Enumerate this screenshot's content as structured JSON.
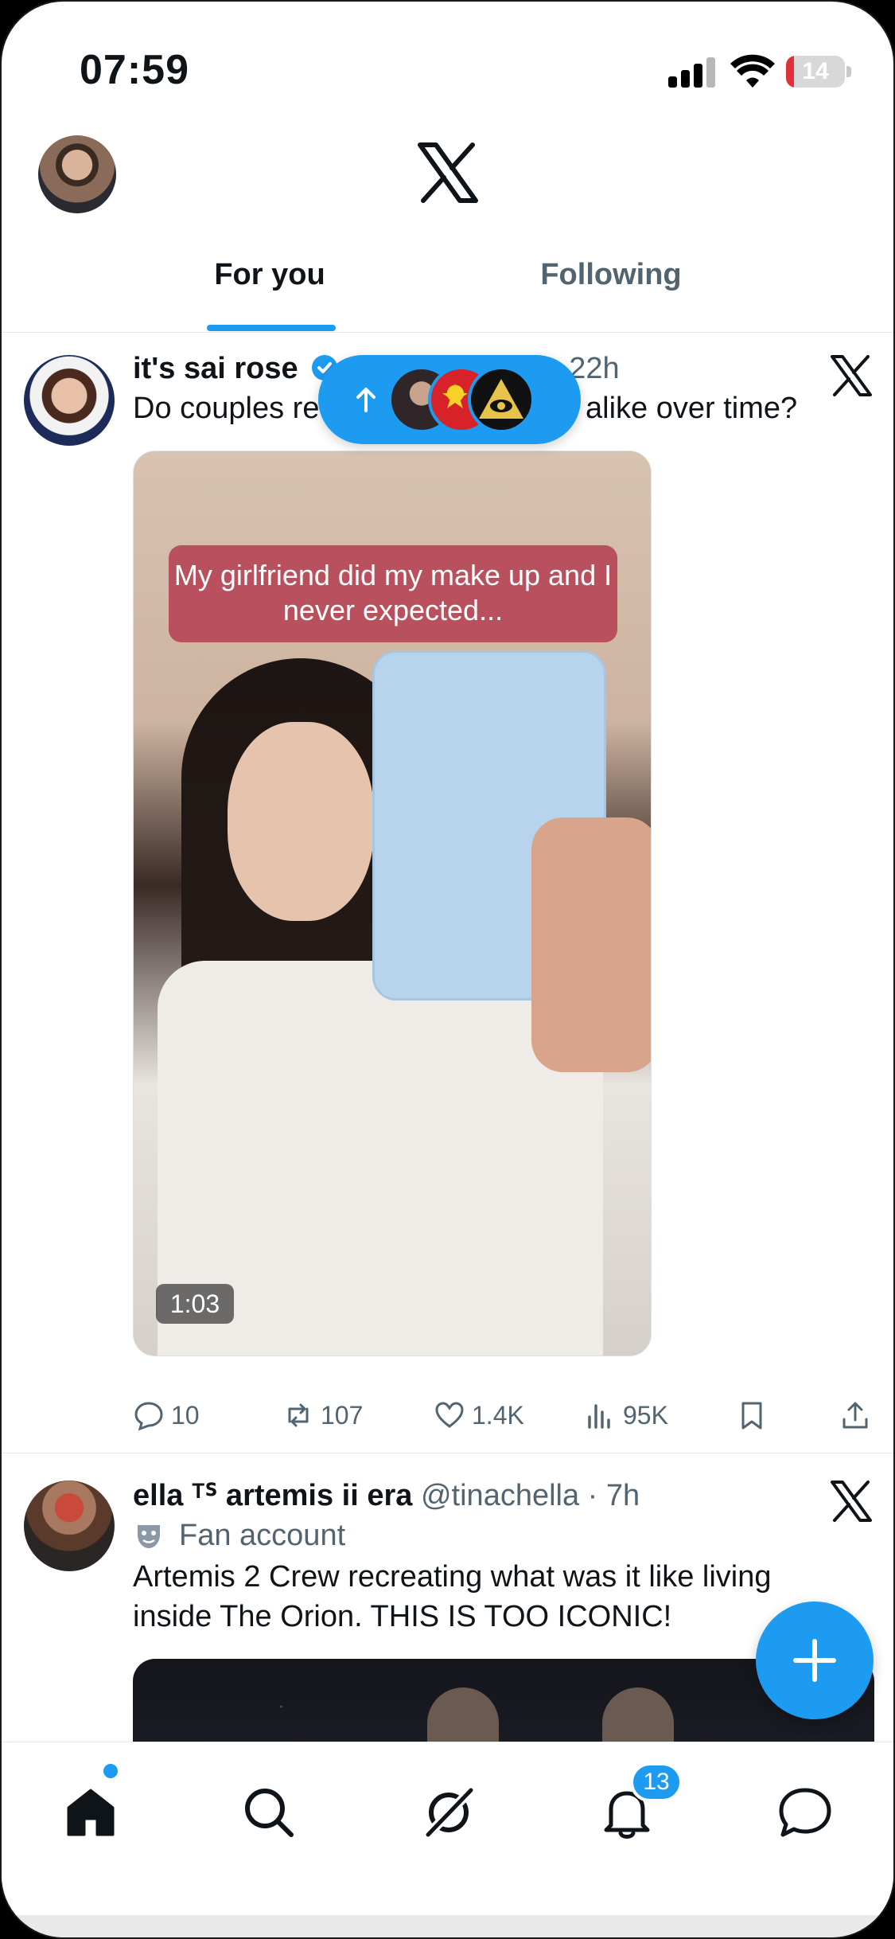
{
  "status_bar": {
    "time": "07:59",
    "battery_level": "14"
  },
  "tabs": {
    "for_you": "For you",
    "following": "Following"
  },
  "new_posts_pill": {
    "arrow_icon": "arrow-up-icon"
  },
  "posts": [
    {
      "display_name": "it's sai rose",
      "handle_time": "· 22h",
      "text_left": "Do couples re",
      "text_right": "alike over time?",
      "media": {
        "caption": "My girlfriend did my make up and I never expected...",
        "duration": "1:03"
      },
      "actions": {
        "replies": "10",
        "reposts": "107",
        "likes": "1.4K",
        "views": "95K"
      }
    },
    {
      "display_name": "ella ᵀᔆ artemis ii era",
      "handle_time": "@tinachella · 7h",
      "badge": "Fan account",
      "text": "Artemis 2 Crew recreating what was it like living inside The Orion. THIS IS TOO ICONIC!"
    }
  ],
  "tabbar": {
    "notifications_badge": "13"
  },
  "colors": {
    "accent": "#1d9bf0",
    "text": "#0f1419",
    "secondary": "#536471"
  }
}
